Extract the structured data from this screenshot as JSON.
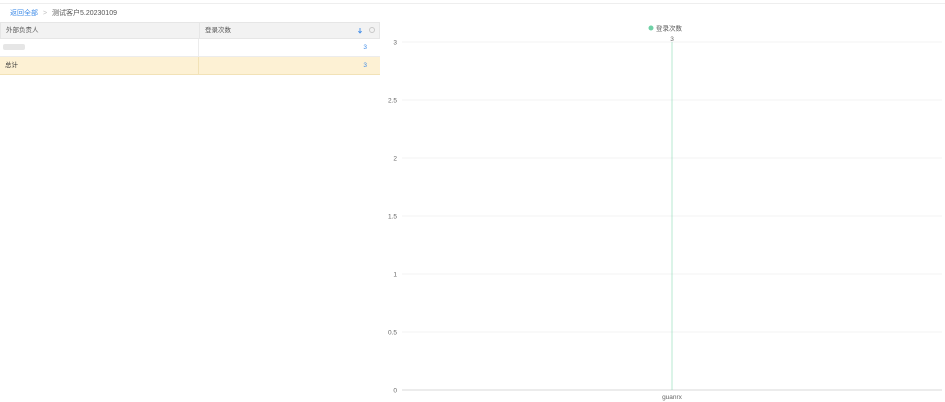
{
  "breadcrumb": {
    "back": "返回全部",
    "separator": ">",
    "current": "测试客户5.20230109"
  },
  "table": {
    "headers": [
      "外部负责人",
      "登录次数"
    ],
    "rows": [
      {
        "name": "",
        "value": "3"
      }
    ],
    "total": {
      "label": "总计",
      "value": "3"
    }
  },
  "chart_data": {
    "type": "bar",
    "categories": [
      "guanrx"
    ],
    "series": [
      {
        "name": "登录次数",
        "values": [
          3
        ]
      }
    ],
    "data_labels": [
      "3"
    ],
    "ylim": [
      0,
      3
    ],
    "yticks": [
      "3",
      "2.5",
      "2",
      "1.5",
      "1",
      "0.5",
      "0"
    ],
    "legend_position": "top-right",
    "grid": true,
    "series_color": "#6fd1a6"
  }
}
